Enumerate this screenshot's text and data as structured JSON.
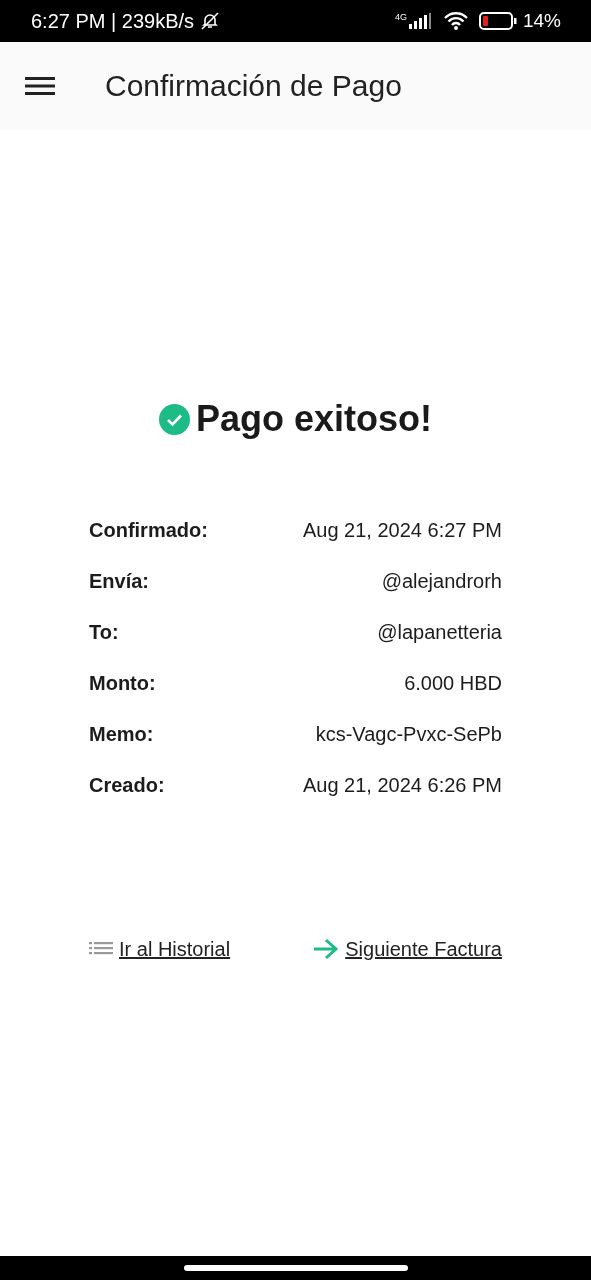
{
  "status_bar": {
    "time": "6:27 PM | 239kB/s",
    "network": "4G",
    "battery": "14%"
  },
  "app_bar": {
    "title": "Confirmación de Pago"
  },
  "result": {
    "title": "Pago exitoso!"
  },
  "details": [
    {
      "label": "Confirmado:",
      "value": "Aug 21, 2024 6:27 PM"
    },
    {
      "label": "Envía:",
      "value": "@alejandrorh"
    },
    {
      "label": "To:",
      "value": "@lapanetteria"
    },
    {
      "label": "Monto:",
      "value": "6.000 HBD"
    },
    {
      "label": "Memo:",
      "value": "kcs-Vagc-Pvxc-SePb"
    },
    {
      "label": "Creado:",
      "value": "Aug 21, 2024 6:26 PM"
    }
  ],
  "actions": [
    {
      "kind": "history",
      "label": "Ir al Historial"
    },
    {
      "kind": "next",
      "label": "Siguiente Factura"
    }
  ]
}
